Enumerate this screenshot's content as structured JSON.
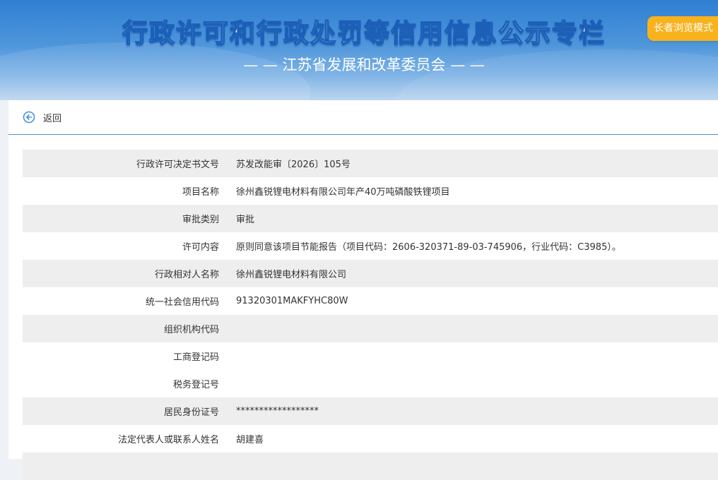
{
  "header": {
    "title": "行政许可和行政处罚等信用信息公示专栏",
    "subtitle": "— — 江苏省发展和改革委员会 — —",
    "elder_mode_label": "长者浏览模式"
  },
  "nav": {
    "back_label": "返回",
    "back_icon": "back-arrow-icon"
  },
  "colors": {
    "header_blue": "#2f7fd2",
    "accent_orange": "#f7b21e",
    "row_shade": "#eeeeee"
  },
  "fields": [
    {
      "label": "行政许可决定书文号",
      "value": "苏发改能审〔2026〕105号"
    },
    {
      "label": "项目名称",
      "value": "徐州鑫锐锂电材料有限公司年产40万吨磷酸铁锂项目"
    },
    {
      "label": "审批类别",
      "value": "审批"
    },
    {
      "label": "许可内容",
      "value": "原则同意该项目节能报告（项目代码：2606-320371-89-03-745906，行业代码：C3985）。"
    },
    {
      "label": "行政相对人名称",
      "value": "徐州鑫锐锂电材料有限公司"
    },
    {
      "label": "统一社会信用代码",
      "value": "91320301MAKFYHC80W"
    },
    {
      "label": "组织机构代码",
      "value": ""
    },
    {
      "label": "工商登记码",
      "value": ""
    },
    {
      "label": "税务登记号",
      "value": ""
    },
    {
      "label": "居民身份证号",
      "value": "******************"
    },
    {
      "label": "法定代表人或联系人姓名",
      "value": "胡建喜"
    },
    {
      "label": "",
      "value": ""
    }
  ]
}
